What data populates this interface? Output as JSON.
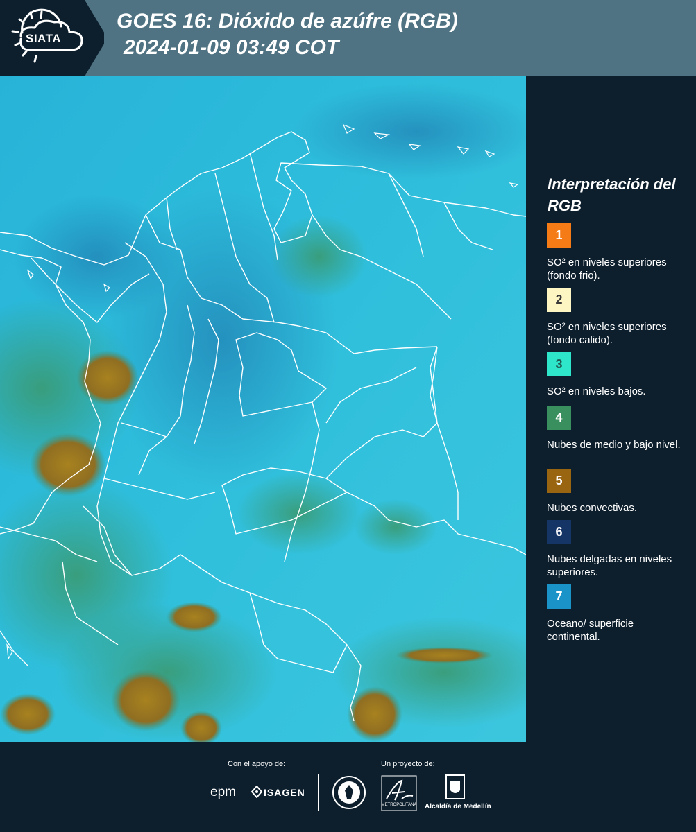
{
  "header": {
    "logo_text": "SIATA",
    "title_line1": "GOES 16: Dióxido de azúfre (RGB)",
    "title_line2": "2024-01-09 03:49 COT"
  },
  "legend": {
    "title": "Interpretación del RGB",
    "items": [
      {
        "number": "1",
        "color": "#f47b16",
        "label": "SO² en niveles superiores (fondo frio)."
      },
      {
        "number": "2",
        "color": "#fdf6c3",
        "label": "SO² en niveles superiores (fondo calido)."
      },
      {
        "number": "3",
        "color": "#2ee6c9",
        "label": "SO² en niveles bajos."
      },
      {
        "number": "4",
        "color": "#3a8f5f",
        "label": "Nubes de medio y bajo nivel."
      },
      {
        "number": "5",
        "color": "#9a6511",
        "label": "Nubes convectivas."
      },
      {
        "number": "6",
        "color": "#163567",
        "label": "Nubes delgadas en niveles superiores."
      },
      {
        "number": "7",
        "color": "#1a93c9",
        "label": "Oceano/ superficie continental."
      }
    ]
  },
  "footer": {
    "support_label": "Con el apoyo de:",
    "project_label": "Un proyecto de:",
    "sponsors": [
      "epm",
      "ISAGEN"
    ],
    "metro_label": "METROPOLITANA",
    "alcaldia_label": "Alcaldía de Medellín"
  }
}
